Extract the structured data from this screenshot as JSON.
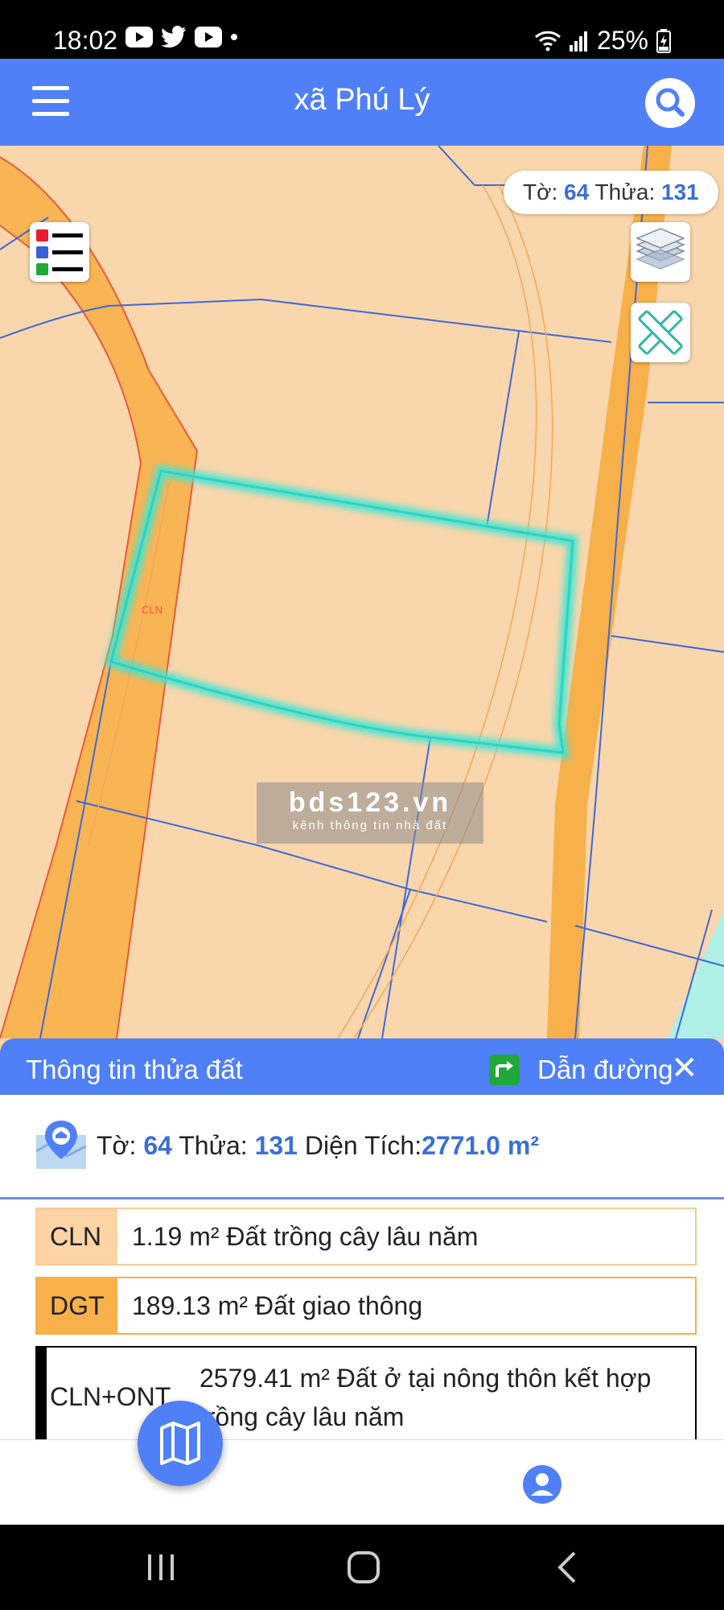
{
  "status_bar": {
    "time": "18:02",
    "battery": "25%",
    "apps": [
      "youtube-icon",
      "twitter-icon",
      "youtube-icon"
    ]
  },
  "app_bar": {
    "title": "xã Phú Lý",
    "menu_icon": "menu-icon",
    "search_icon": "search-icon"
  },
  "map": {
    "parcel_pill": {
      "to_label": "Tờ:",
      "to_value": "64",
      "thua_label": "Thửa:",
      "thua_value": "131"
    },
    "land_label": "CLN",
    "watermark": {
      "title": "bds123.vn",
      "subtitle": "kênh thông tin nhà đất"
    },
    "colors": {
      "land": "#f9d6ab",
      "road": "#f8b04a",
      "boundary": "#3f68d8",
      "selected": "#3fe6d6",
      "accent": "#4f80f7"
    }
  },
  "panel": {
    "title": "Thông tin thửa đất",
    "directions_label": "Dẫn đường",
    "close_icon": "close-icon",
    "summary": {
      "to_label": "Tờ:",
      "to_value": "64",
      "thua_label": "Thửa:",
      "thua_value": "131",
      "area_label": "Diện Tích:",
      "area_value": "2771.0 m²"
    },
    "usages": [
      {
        "code": "CLN",
        "description": "1.19 m²  Đất trồng cây lâu năm",
        "color": "#fdd4a5"
      },
      {
        "code": "DGT",
        "description": "189.13 m²  Đất giao thông",
        "color": "#f8b04a"
      },
      {
        "code": "CLN+ONT",
        "description": "2579.41 m²  Đất ở tại nông thôn kết hợp trồng cây lâu năm",
        "color": "#000000"
      }
    ]
  },
  "bottom_nav": {
    "map_icon": "map-icon",
    "profile_icon": "profile-icon"
  }
}
